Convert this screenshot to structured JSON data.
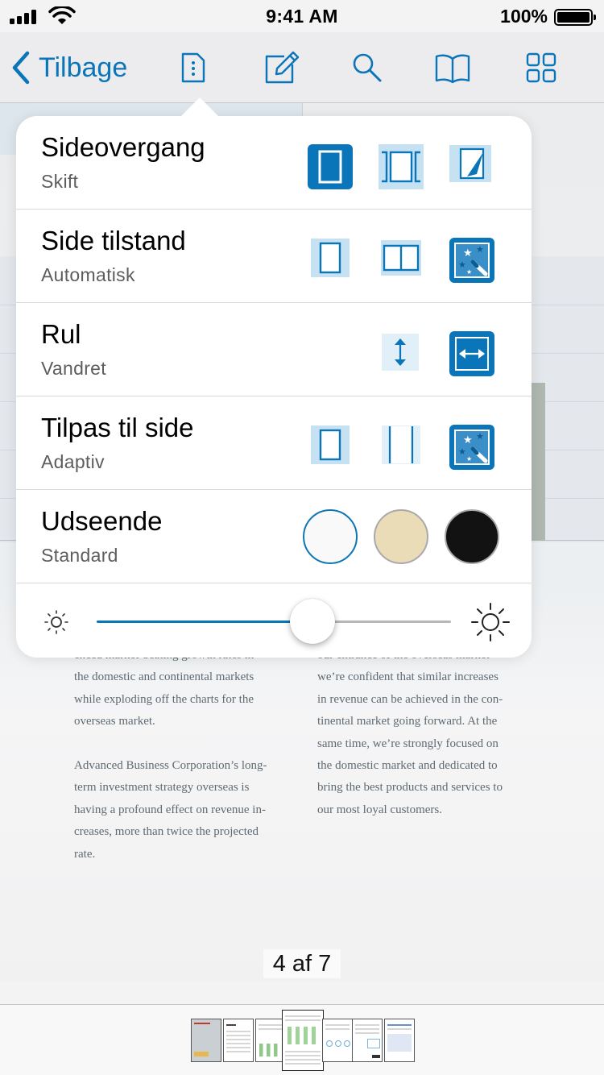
{
  "status_bar": {
    "time": "9:41 AM",
    "battery": "100%"
  },
  "nav": {
    "back_label": "Tilbage"
  },
  "document": {
    "left_column": [
      "enced market-beating growth rates in",
      "the domestic and continental markets",
      "while exploding off the charts for the",
      "overseas market.",
      "",
      "Advanced Business Corporation’s long-",
      "term investment strategy overseas is",
      "having a profound effect on revenue in-",
      "creases, more than twice the projected",
      "rate."
    ],
    "right_column": [
      "our entrance of the overseas market",
      "we’re confident that similar increases",
      "in revenue can be achieved in the con-",
      "tinental market going forward. At the",
      "same time, we’re strongly focused on",
      "the domestic market and dedicated to",
      "bring the best products and services to",
      "our most loyal customers."
    ]
  },
  "page_indicator": "4 af 7",
  "settings": {
    "transition": {
      "title": "Sideovergang",
      "value": "Skift"
    },
    "page_mode": {
      "title": "Side tilstand",
      "value": "Automatisk"
    },
    "scroll": {
      "title": "Rul",
      "value": "Vandret"
    },
    "fit": {
      "title": "Tilpas til side",
      "value": "Adaptiv"
    },
    "appearance": {
      "title": "Udseende",
      "value": "Standard"
    }
  },
  "appearance_swatches": [
    "#f9f9f9",
    "#ebdcb8",
    "#121212"
  ],
  "brightness": 0.61,
  "colors": {
    "accent": "#0a75b8",
    "accent_light": "#c6e1f2"
  },
  "icons": {
    "nav": [
      "chevron-left-icon",
      "document-info-icon",
      "edit-icon",
      "search-icon",
      "bookmarks-book-icon",
      "grid-icon"
    ],
    "brightness": [
      "sun-small-icon",
      "sun-large-icon"
    ]
  }
}
